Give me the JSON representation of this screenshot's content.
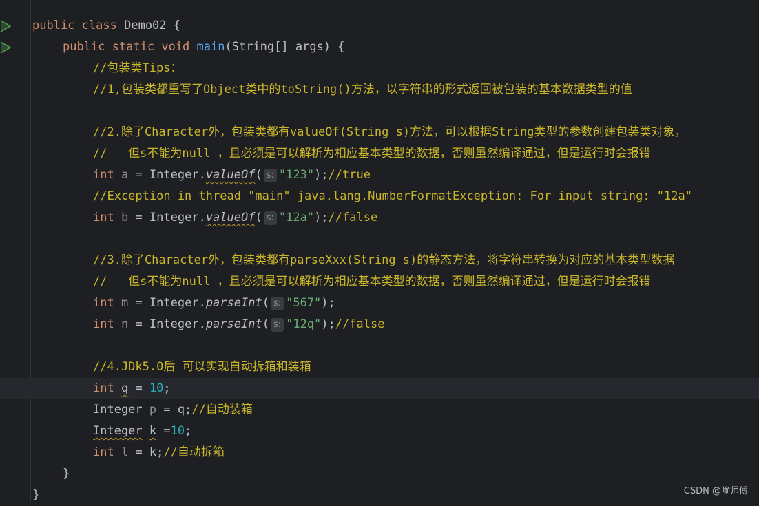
{
  "editor": {
    "lines": {
      "l1": {
        "kw1": "public",
        "kw2": "class",
        "name": "Demo02",
        "brace": "{"
      },
      "l2": {
        "kw1": "public",
        "kw2": "static",
        "kw3": "void",
        "method": "main",
        "params": "(String[] args) {"
      },
      "l3": {
        "comment": "//包装类Tips："
      },
      "l4": {
        "comment": "//1,包装类都重写了Object类中的toString()方法，以字符串的形式返回被包装的基本数据类型的值"
      },
      "l6": {
        "comment": "//2.除了Character外，包装类都有valueOf(String s)方法，可以根据String类型的参数创建包装类对象，"
      },
      "l7": {
        "comment": "//   但s不能为null ，且必须是可以解析为相应基本类型的数据，否则虽然编译通过，但是运行时会报错"
      },
      "l8": {
        "type": "int",
        "var": "a",
        "eq": " = Integer.",
        "method": "valueOf",
        "open": "(",
        "hint": "s:",
        "arg": "\"123\"",
        "close": ");",
        "comment": "//true"
      },
      "l9": {
        "comment": "//Exception in thread \"main\" java.lang.NumberFormatException: For input string: \"12a\""
      },
      "l10": {
        "type": "int",
        "var": "b",
        "eq": " = Integer.",
        "method": "valueOf",
        "open": "(",
        "hint": "s:",
        "arg": "\"12a\"",
        "close": ");",
        "comment": "//false"
      },
      "l12": {
        "comment": "//3.除了Character外，包装类都有parseXxx(String s)的静态方法，将字符串转换为对应的基本类型数据"
      },
      "l13": {
        "comment": "//   但s不能为null ，且必须是可以解析为相应基本类型的数据，否则虽然编译通过，但是运行时会报错"
      },
      "l14": {
        "type": "int",
        "var": "m",
        "eq": " = Integer.",
        "method": "parseInt",
        "open": "(",
        "hint": "s:",
        "arg": "\"567\"",
        "close": ");"
      },
      "l15": {
        "type": "int",
        "var": "n",
        "eq": " = Integer.",
        "method": "parseInt",
        "open": "(",
        "hint": "s:",
        "arg": "\"12q\"",
        "close": ");",
        "comment": "//false"
      },
      "l17": {
        "comment": "//4.JDk5.0后 可以实现自动拆箱和装箱"
      },
      "l18": {
        "type": "int",
        "var": "q",
        "eq": " = ",
        "num": "10",
        "end": ";"
      },
      "l19": {
        "type": "Integer",
        "var": "p",
        "rest": " = q;",
        "comment": "//自动装箱"
      },
      "l20": {
        "type": "Integer",
        "var": "k",
        "eq": " =",
        "num": "10",
        "end": ";"
      },
      "l21": {
        "type": "int",
        "var": "l",
        "rest": " = k;",
        "comment": "//自动拆箱"
      },
      "l22": {
        "brace": "}"
      },
      "l23": {
        "brace": "}"
      }
    }
  },
  "watermark": "CSDN @喻师傅"
}
